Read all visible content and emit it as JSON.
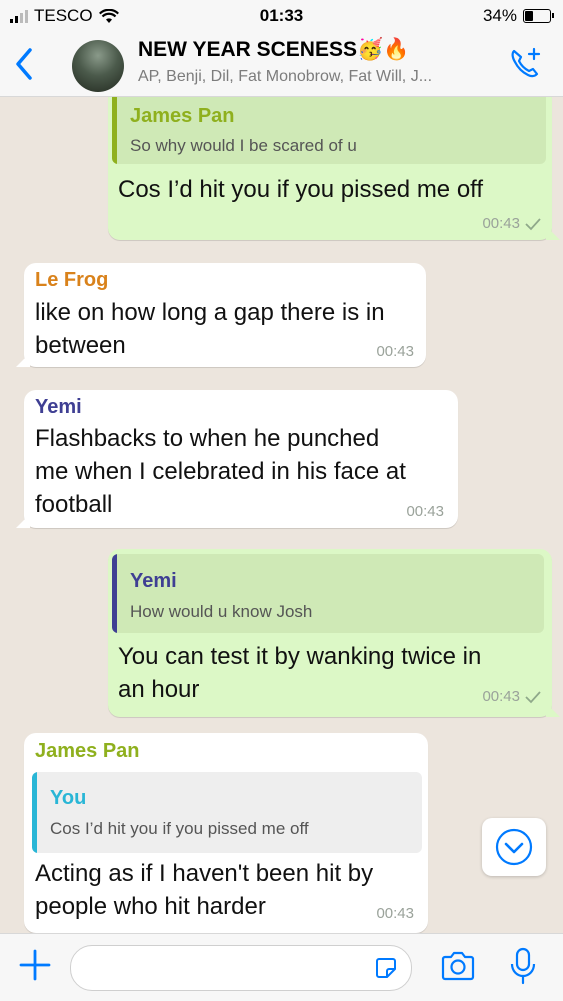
{
  "status_bar": {
    "carrier": "TESCO",
    "time": "01:33",
    "battery": "34%",
    "battery_level": 0.34
  },
  "header": {
    "title": "NEW YEAR SCENESS🥳🔥",
    "subtitle": "AP, Benji, Dil, Fat Monobrow, Fat Will, J..."
  },
  "colors": {
    "accent_blue": "#007aff",
    "outgoing_bubble": "#dcf8c6",
    "incoming_bubble": "#ffffff",
    "chat_background": "#ece5dd",
    "name_james_pan": "#8fb01e",
    "name_le_frog": "#d9821b",
    "name_yemi": "#3f3f93",
    "name_you": "#29b6d6"
  },
  "messages": [
    {
      "direction": "out",
      "quote": {
        "name": "James Pan",
        "text": "So why would I be scared of u"
      },
      "text": "Cos I’d hit you if you pissed me off",
      "time": "00:43"
    },
    {
      "direction": "in",
      "sender": "Le Frog",
      "lines": [
        "like on how long a gap there is in",
        "between"
      ],
      "time": "00:43"
    },
    {
      "direction": "in",
      "sender": "Yemi",
      "lines": [
        "Flashbacks to when he punched",
        "me when I celebrated in his face at",
        "football"
      ],
      "time": "00:43"
    },
    {
      "direction": "out",
      "quote": {
        "name": "Yemi",
        "text": "How would u know Josh"
      },
      "lines": [
        "You can test it by wanking twice in",
        "an hour"
      ],
      "time": "00:43"
    },
    {
      "direction": "in",
      "sender": "James Pan",
      "quote": {
        "name": "You",
        "text": "Cos I’d hit you if you pissed me off"
      },
      "lines": [
        "Acting as if I haven't been hit by",
        "people who hit harder"
      ],
      "time": "00:43"
    }
  ],
  "composer": {
    "placeholder": ""
  },
  "icons": {
    "back": "chevron-left-icon",
    "call": "add-call-icon",
    "scroll_down": "chevron-down-icon",
    "attach": "plus-icon",
    "sticker": "sticker-icon",
    "camera": "camera-icon",
    "mic": "microphone-icon"
  }
}
